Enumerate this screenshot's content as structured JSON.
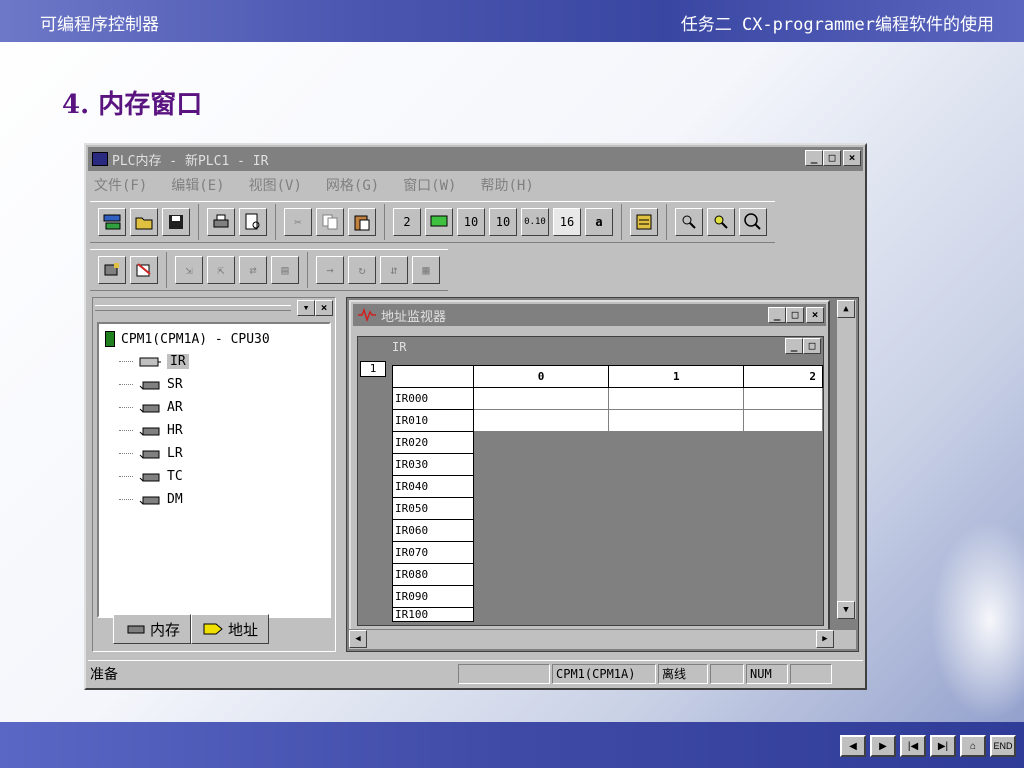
{
  "slide": {
    "header_left": "可编程序控制器",
    "header_right": "任务二 CX-programmer编程软件的使用",
    "section_title": "4. 内存窗口"
  },
  "window": {
    "title": "PLC内存 - 新PLC1 - IR",
    "controls": [
      "_",
      "□",
      "×"
    ]
  },
  "menu": [
    "文件(F)",
    "编辑(E)",
    "视图(V)",
    "网格(G)",
    "窗口(W)",
    "帮助(H)"
  ],
  "toolbar1": {
    "groups": [
      [
        "new-icon",
        "open-icon",
        "save-icon"
      ],
      [
        "print-icon",
        "print-preview-icon"
      ],
      [
        "cut-icon",
        "copy-icon",
        "paste-icon"
      ],
      [
        "binary-icon",
        "bcd-icon",
        "decimal-icon",
        "signed-decimal-icon",
        "float-icon",
        "hex-icon",
        "text-icon"
      ],
      [
        "list-icon"
      ],
      [
        "find-icon",
        "find-replace-icon",
        "zoom-icon"
      ]
    ],
    "labels": {
      "binary": "2",
      "decimal": "10",
      "signed": "10",
      "float": "0.10",
      "hex": "16",
      "text": "a"
    }
  },
  "toolbar2": {
    "groups": [
      [
        "monitor-icon",
        "edit-icon"
      ],
      [
        "transfer-to-plc-icon",
        "transfer-from-plc-icon",
        "compare-icon",
        "clear-icon"
      ],
      [
        "force-icon",
        "set-icon",
        "reset-icon",
        "force-cancel-icon"
      ]
    ]
  },
  "tree": {
    "root": "CPM1(CPM1A) - CPU30",
    "items": [
      "IR",
      "SR",
      "AR",
      "HR",
      "LR",
      "TC",
      "DM"
    ],
    "selected": "IR",
    "tabs": [
      "内存",
      "地址"
    ]
  },
  "monitor_window": {
    "title": "地址监视器"
  },
  "ir_window": {
    "title": "IR",
    "row_index": "1",
    "columns": [
      "0",
      "1",
      "2"
    ],
    "rows": [
      "IR000",
      "IR010",
      "IR020",
      "IR030",
      "IR040",
      "IR050",
      "IR060",
      "IR070",
      "IR080",
      "IR090",
      "IR100"
    ]
  },
  "status": {
    "ready": "准备",
    "plc": "CPM1(CPM1A)",
    "mode": "离线",
    "num": "NUM"
  },
  "nav_buttons": [
    "prev",
    "next",
    "first",
    "last",
    "home",
    "END"
  ]
}
